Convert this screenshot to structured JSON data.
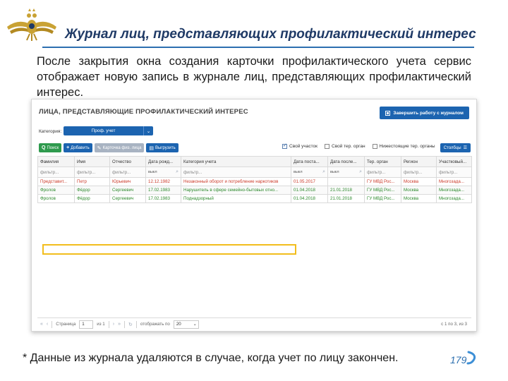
{
  "slide": {
    "title": "Журнал лиц, представляющих профилактический интерес",
    "intro": "После закрытия окна создания карточки профилактического учета сервис отображает новую запись в журнале лиц, представляющих профилактический интерес.",
    "footnote": "* Данные из журнала удаляются в случае, когда учет по лицу закончен.",
    "page_number": "179"
  },
  "app": {
    "title": "ЛИЦА, ПРЕДСТАВЛЯЮЩИЕ ПРОФИЛАКТИЧЕСКИЙ ИНТЕРЕС",
    "finish_button": "Завершить работу с журналом",
    "category_label": "Категория:",
    "category_value": "Проф. учет",
    "toolbar": {
      "search": "Поиск",
      "add": "Добавить",
      "card": "Карточка физ. лица",
      "export": "Выгрузить"
    },
    "filters": {
      "own_participant": "Свой участок",
      "own_organ": "Свой тер. орган",
      "lower_organs": "Нижестоящие тер. органы"
    },
    "columns_button": "Столбцы",
    "columns": [
      "Фамилия",
      "Имя",
      "Отчество",
      "Дата рожд...",
      "Категория учета",
      "Дата поста...",
      "Дата после...",
      "Тер. орган",
      "Регион",
      "Участковый..."
    ],
    "filter_row": [
      "фильтр...",
      "фильтр...",
      "фильтр...",
      "выкл",
      "фильтр...",
      "выкл",
      "выкл",
      "фильтр...",
      "фильтр...",
      "фильтр..."
    ],
    "rows": [
      [
        "Представит...",
        "Петр",
        "Юрьевич",
        "12.12.1982",
        "Незаконный оборот и потребление наркотиков",
        "01.05.2017",
        "",
        "ГУ МВД Рос...",
        "Москва",
        "Многозада..."
      ],
      [
        "Фролов",
        "Фёдор",
        "Сергеевич",
        "17.02.1983",
        "Нарушитель в сфере семейно-бытовых отно...",
        "01.04.2018",
        "21.01.2018",
        "ГУ МВД Рос...",
        "Москва",
        "Многозада..."
      ],
      [
        "Фролов",
        "Фёдор",
        "Сергеевич",
        "17.02.1983",
        "Поднадзорный",
        "01.04.2018",
        "21.01.2018",
        "ГУ МВД Рос...",
        "Москва",
        "Многозада..."
      ]
    ],
    "pager": {
      "page_label": "Страница",
      "page_value": "1",
      "of_label": "из 1",
      "show_label": "отображать по",
      "page_size": "20",
      "range": "с 1 по 3, из 3"
    },
    "colors": {
      "accent": "#1c64b0",
      "green": "#2e9a4d",
      "highlight": "#f2bd1d",
      "row_red": "#cc3b2b",
      "row_green": "#2e8a2e"
    }
  }
}
